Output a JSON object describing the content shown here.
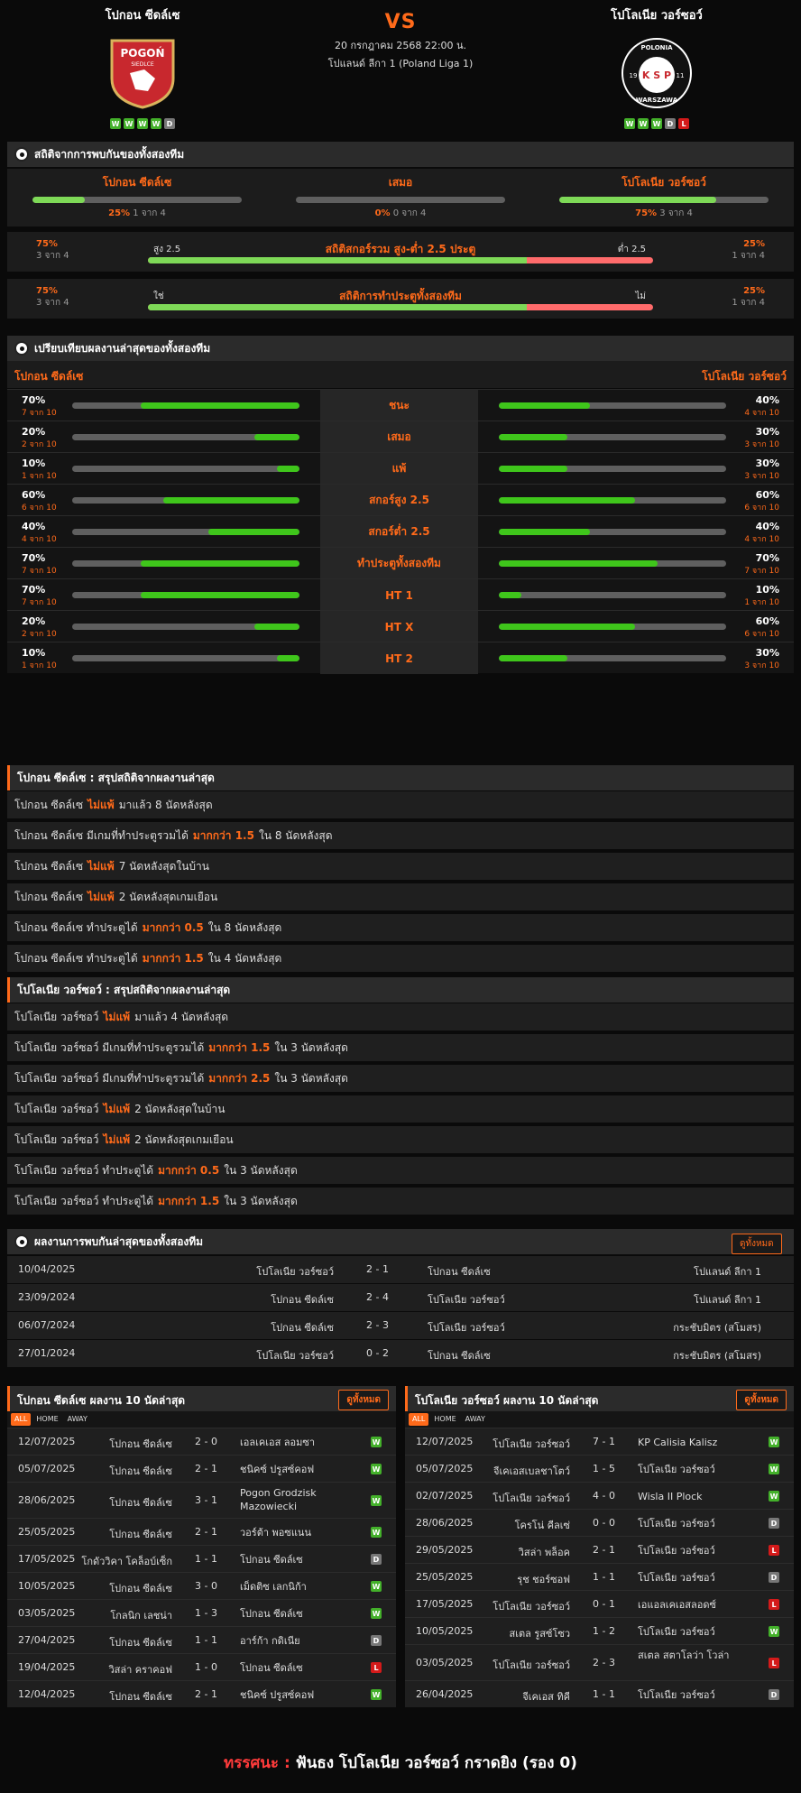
{
  "header": {
    "home_name": "โปกอน ซีดล์เซ",
    "away_name": "โปโลเนีย วอร์ซอว์",
    "vs": "VS",
    "datetime": "20 กรกฎาคม 2568 22:00 น.",
    "league": "โปแลนด์ ลีกา 1 (Poland Liga 1)",
    "home_form": [
      "W",
      "W",
      "W",
      "W",
      "D"
    ],
    "away_form": [
      "W",
      "W",
      "W",
      "D",
      "L"
    ],
    "home_logo_text": "POGOŃ",
    "home_logo_sub": "SIEDLCE",
    "away_logo_text": "K S P",
    "away_logo_top": "POLONIA",
    "away_logo_bottom": "WARSZAWA",
    "away_logo_l": "19",
    "away_logo_r": "11"
  },
  "h2h_stats": {
    "title": "สถิติจากการพบกันของทั้งสองทีม",
    "home": {
      "label": "โปกอน ซีดล์เซ",
      "pct": "25%",
      "count": "1 จาก 4",
      "value": 25
    },
    "draw": {
      "label": "เสมอ",
      "pct": "0%",
      "count": "0 จาก 4",
      "value": 0
    },
    "away": {
      "label": "โปโลเนีย วอร์ซอว์",
      "pct": "75%",
      "count": "3 จาก 4",
      "value": 75
    },
    "ou": {
      "title": "สถิติสกอร์รวม สูง-ต่ำ 2.5 ประตู",
      "left_pct": "75%",
      "left_count": "3 จาก 4",
      "left_label": "สูง 2.5",
      "right_label": "ต่ำ 2.5",
      "right_pct": "25%",
      "right_count": "1 จาก 4",
      "value": 75
    },
    "btts": {
      "title": "สถิติการทำประตูทั้งสองทีม",
      "left_pct": "75%",
      "left_count": "3 จาก 4",
      "left_label": "ใช่",
      "right_label": "ไม่",
      "right_pct": "25%",
      "right_count": "1 จาก 4",
      "value": 75
    }
  },
  "compare": {
    "title": "เปรียบเทียบผลงานล่าสุดของทั้งสองทีม",
    "home_name": "โปกอน ซีดล์เซ",
    "away_name": "โปโลเนีย วอร์ซอว์",
    "rows": [
      {
        "label": "ชนะ",
        "hp": "70%",
        "hc": "7 จาก 10",
        "hv": 70,
        "ap": "40%",
        "ac": "4 จาก 10",
        "av": 40
      },
      {
        "label": "เสมอ",
        "hp": "20%",
        "hc": "2 จาก 10",
        "hv": 20,
        "ap": "30%",
        "ac": "3 จาก 10",
        "av": 30
      },
      {
        "label": "แพ้",
        "hp": "10%",
        "hc": "1 จาก 10",
        "hv": 10,
        "ap": "30%",
        "ac": "3 จาก 10",
        "av": 30
      },
      {
        "label": "สกอร์สูง 2.5",
        "hp": "60%",
        "hc": "6 จาก 10",
        "hv": 60,
        "ap": "60%",
        "ac": "6 จาก 10",
        "av": 60
      },
      {
        "label": "สกอร์ต่ำ 2.5",
        "hp": "40%",
        "hc": "4 จาก 10",
        "hv": 40,
        "ap": "40%",
        "ac": "4 จาก 10",
        "av": 40
      },
      {
        "label": "ทำประตูทั้งสองทีม",
        "hp": "70%",
        "hc": "7 จาก 10",
        "hv": 70,
        "ap": "70%",
        "ac": "7 จาก 10",
        "av": 70
      },
      {
        "label": "HT 1",
        "hp": "70%",
        "hc": "7 จาก 10",
        "hv": 70,
        "ap": "10%",
        "ac": "1 จาก 10",
        "av": 10
      },
      {
        "label": "HT X",
        "hp": "20%",
        "hc": "2 จาก 10",
        "hv": 20,
        "ap": "60%",
        "ac": "6 จาก 10",
        "av": 60
      },
      {
        "label": "HT 2",
        "hp": "10%",
        "hc": "1 จาก 10",
        "hv": 10,
        "ap": "30%",
        "ac": "3 จาก 10",
        "av": 30
      }
    ]
  },
  "home_summary": {
    "title": "โปกอน ซีดล์เซ : สรุปสถิติจากผลงานล่าสุด",
    "rows": [
      [
        "โปกอน ซีดล์เซ",
        "ไม่แพ้",
        "มาแล้ว 8 นัดหลังสุด"
      ],
      [
        "โปกอน ซีดล์เซ มีเกมที่ทำประตูรวมได้",
        "มากกว่า 1.5",
        "ใน 8 นัดหลังสุด"
      ],
      [
        "โปกอน ซีดล์เซ",
        "ไม่แพ้",
        "7 นัดหลังสุดในบ้าน"
      ],
      [
        "โปกอน ซีดล์เซ",
        "ไม่แพ้",
        "2 นัดหลังสุดเกมเยือน"
      ],
      [
        "โปกอน ซีดล์เซ ทำประตูได้",
        "มากกว่า 0.5",
        "ใน 8 นัดหลังสุด"
      ],
      [
        "โปกอน ซีดล์เซ ทำประตูได้",
        "มากกว่า 1.5",
        "ใน 4 นัดหลังสุด"
      ]
    ]
  },
  "away_summary": {
    "title": "โปโลเนีย วอร์ซอว์ : สรุปสถิติจากผลงานล่าสุด",
    "rows": [
      [
        "โปโลเนีย วอร์ซอว์",
        "ไม่แพ้",
        "มาแล้ว 4 นัดหลังสุด"
      ],
      [
        "โปโลเนีย วอร์ซอว์ มีเกมที่ทำประตูรวมได้",
        "มากกว่า 1.5",
        "ใน 3 นัดหลังสุด"
      ],
      [
        "โปโลเนีย วอร์ซอว์ มีเกมที่ทำประตูรวมได้",
        "มากกว่า 2.5",
        "ใน 3 นัดหลังสุด"
      ],
      [
        "โปโลเนีย วอร์ซอว์",
        "ไม่แพ้",
        "2 นัดหลังสุดในบ้าน"
      ],
      [
        "โปโลเนีย วอร์ซอว์",
        "ไม่แพ้",
        "2 นัดหลังสุดเกมเยือน"
      ],
      [
        "โปโลเนีย วอร์ซอว์ ทำประตูได้",
        "มากกว่า 0.5",
        "ใน 3 นัดหลังสุด"
      ],
      [
        "โปโลเนีย วอร์ซอว์ ทำประตูได้",
        "มากกว่า 1.5",
        "ใน 3 นัดหลังสุด"
      ]
    ]
  },
  "h2h_results": {
    "title": "ผลงานการพบกันล่าสุดของทั้งสองทีม",
    "view_all": "ดูทั้งหมด",
    "rows": [
      [
        "10/04/2025",
        "โปโลเนีย วอร์ซอว์",
        "2 - 1",
        "โปกอน ซีดล์เซ",
        "โปแลนด์ ลีกา 1"
      ],
      [
        "23/09/2024",
        "โปกอน ซีดล์เซ",
        "2 - 4",
        "โปโลเนีย วอร์ซอว์",
        "โปแลนด์ ลีกา 1"
      ],
      [
        "06/07/2024",
        "โปกอน ซีดล์เซ",
        "2 - 3",
        "โปโลเนีย วอร์ซอว์",
        "กระชับมิตร (สโมสร)"
      ],
      [
        "27/01/2024",
        "โปโลเนีย วอร์ซอว์",
        "0 - 2",
        "โปกอน ซีดล์เซ",
        "กระชับมิตร (สโมสร)"
      ]
    ]
  },
  "home_last10": {
    "title": "โปกอน ซีดล์เซ ผลงาน 10 นัดล่าสุด",
    "view_all": "ดูทั้งหมด",
    "tabs": [
      "ALL",
      "HOME",
      "AWAY"
    ],
    "rows": [
      [
        "12/07/2025",
        "โปกอน ซีดล์เซ",
        "2 - 0",
        "เอลเคเอส ลอมซา",
        "W"
      ],
      [
        "05/07/2025",
        "โปกอน ซีดล์เซ",
        "2 - 1",
        "ชนิคซ์ ปรูสซ์คอฟ",
        "W"
      ],
      [
        "28/06/2025",
        "โปกอน ซีดล์เซ",
        "3 - 1",
        "Pogon Grodzisk Mazowiecki",
        "W"
      ],
      [
        "25/05/2025",
        "โปกอน ซีดล์เซ",
        "2 - 1",
        "วอร์ต้า พอซแนน",
        "W"
      ],
      [
        "17/05/2025",
        "โกดัววิคา โคล็อบ์เซ็ก",
        "1 - 1",
        "โปกอน ซีดล์เซ",
        "D"
      ],
      [
        "10/05/2025",
        "โปกอน ซีดล์เซ",
        "3 - 0",
        "เม็ดติซ เลกนิก้า",
        "W"
      ],
      [
        "03/05/2025",
        "โกลนิก เลชน่า",
        "1 - 3",
        "โปกอน ซีดล์เซ",
        "W"
      ],
      [
        "27/04/2025",
        "โปกอน ซีดล์เซ",
        "1 - 1",
        "อาร์ก้า กดิเนีย",
        "D"
      ],
      [
        "19/04/2025",
        "วิสล่า คราคอฟ",
        "1 - 0",
        "โปกอน ซีดล์เซ",
        "L"
      ],
      [
        "12/04/2025",
        "โปกอน ซีดล์เซ",
        "2 - 1",
        "ชนิคซ์ ปรูสซ์คอฟ",
        "W"
      ]
    ]
  },
  "away_last10": {
    "title": "โปโลเนีย วอร์ซอว์ ผลงาน 10 นัดล่าสุด",
    "view_all": "ดูทั้งหมด",
    "tabs": [
      "ALL",
      "HOME",
      "AWAY"
    ],
    "rows": [
      [
        "12/07/2025",
        "โปโลเนีย วอร์ซอว์",
        "7 - 1",
        "KP Calisia Kalisz",
        "W"
      ],
      [
        "05/07/2025",
        "จีเคเอสเบลชาโตว์",
        "1 - 5",
        "โปโลเนีย วอร์ซอว์",
        "W"
      ],
      [
        "02/07/2025",
        "โปโลเนีย วอร์ซอว์",
        "4 - 0",
        "Wisla II Plock",
        "W"
      ],
      [
        "28/06/2025",
        "โครโน่ คีลเซ่",
        "0 - 0",
        "โปโลเนีย วอร์ซอว์",
        "D"
      ],
      [
        "29/05/2025",
        "วิสล่า พล็อค",
        "2 - 1",
        "โปโลเนีย วอร์ซอว์",
        "L"
      ],
      [
        "25/05/2025",
        "รุช ชอร์ซอฟ",
        "1 - 1",
        "โปโลเนีย วอร์ซอว์",
        "D"
      ],
      [
        "17/05/2025",
        "โปโลเนีย วอร์ซอว์",
        "0 - 1",
        "เอแอลเคเอสลอดซ์",
        "L"
      ],
      [
        "10/05/2025",
        "สเตล รูสซ์โซว",
        "1 - 2",
        "โปโลเนีย วอร์ซอว์",
        "W"
      ],
      [
        "03/05/2025",
        "โปโลเนีย วอร์ซอว์",
        "2 - 3",
        "สเตล สตาโลว่า โวล่า",
        "L"
      ],
      [
        "26/04/2025",
        "จีเคเอส ทิคี",
        "1 - 1",
        "โปโลเนีย วอร์ซอว์",
        "D"
      ]
    ]
  },
  "verdict": {
    "label": "ทรรศนะ :",
    "text": "ฟันธง โปโลเนีย วอร์ซอว์ กราดยิง (รอง 0)"
  }
}
